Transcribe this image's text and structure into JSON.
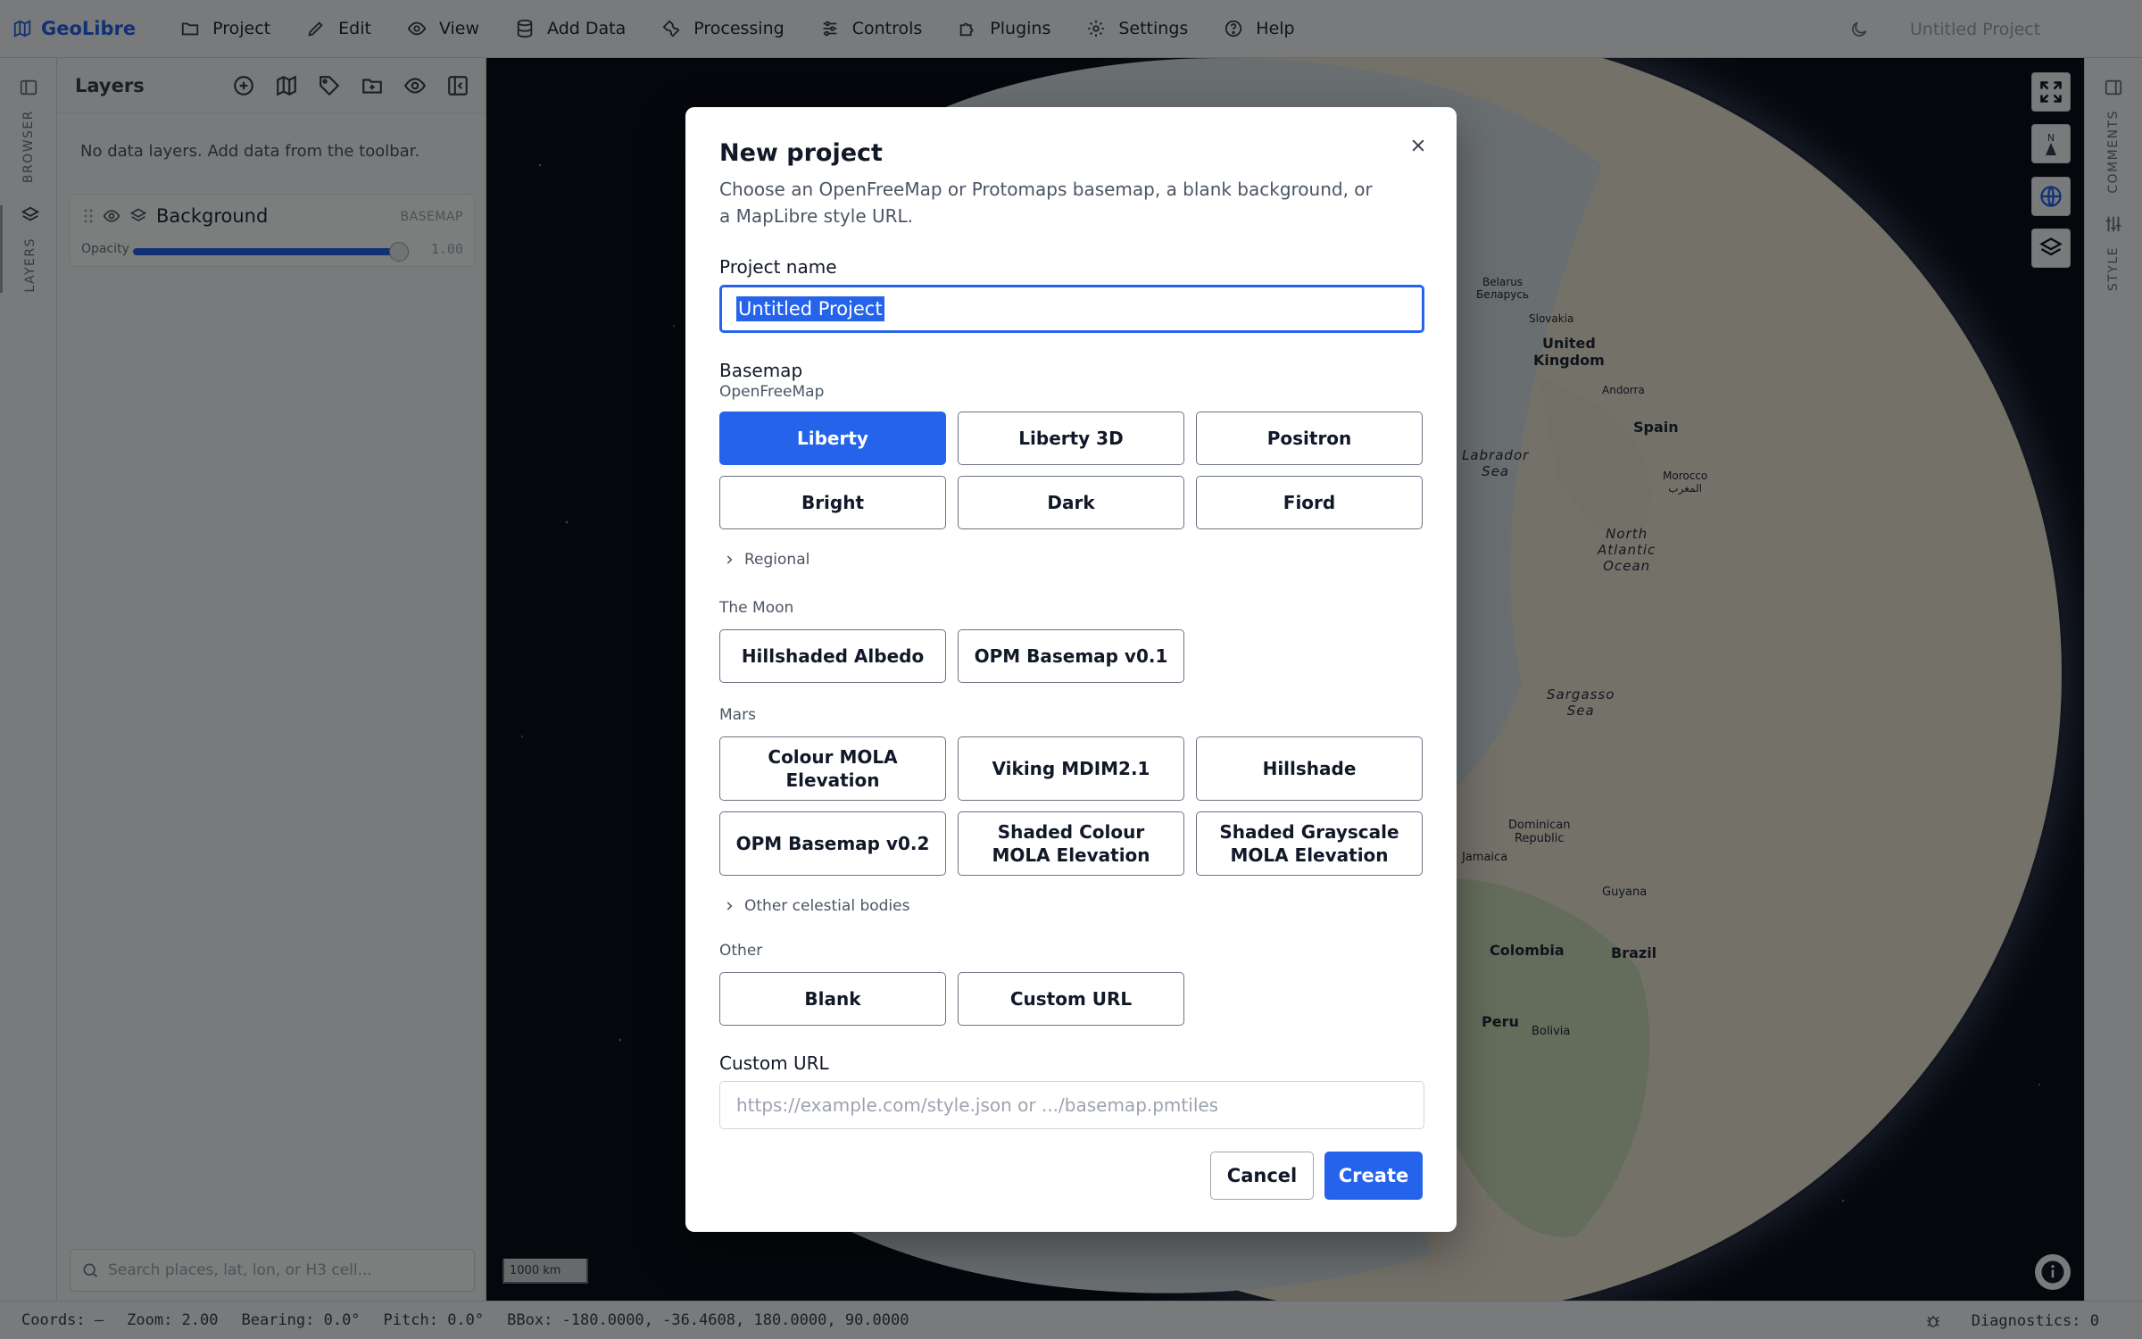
{
  "app": {
    "brand": "GeoLibre",
    "project_title": "Untitled Project",
    "accent_color": "#2563eb"
  },
  "menubar": {
    "items": [
      {
        "label": "Project",
        "icon": "folder-icon"
      },
      {
        "label": "Edit",
        "icon": "pencil-icon"
      },
      {
        "label": "View",
        "icon": "eye-icon"
      },
      {
        "label": "Add Data",
        "icon": "database-icon"
      },
      {
        "label": "Processing",
        "icon": "wrench-icon"
      },
      {
        "label": "Controls",
        "icon": "sliders-icon"
      },
      {
        "label": "Plugins",
        "icon": "puzzle-icon"
      },
      {
        "label": "Settings",
        "icon": "gear-icon"
      },
      {
        "label": "Help",
        "icon": "help-circle-icon"
      }
    ]
  },
  "left_rail": {
    "browser_label": "BROWSER",
    "layers_label": "LAYERS"
  },
  "right_rail": {
    "comments_label": "COMMENTS",
    "style_label": "STYLE"
  },
  "layers_panel": {
    "title": "Layers",
    "empty_message": "No data layers. Add data from the toolbar.",
    "layer": {
      "name": "Background",
      "badge": "BASEMAP",
      "opacity_label": "Opacity",
      "opacity_value": "1.00",
      "opacity_fraction": 1.0
    },
    "search_placeholder": "Search places, lat, lon, or H3 cell..."
  },
  "map": {
    "scale_label": "1000 km",
    "compass_label": "N",
    "labels": [
      {
        "text": "Belarus\nБеларусь"
      },
      {
        "text": "Slovakia"
      },
      {
        "text": "United\nKingdom"
      },
      {
        "text": "Andorra"
      },
      {
        "text": "Spain"
      },
      {
        "text": "Morocco\nالمغرب"
      },
      {
        "text": "Labrador\nSea"
      },
      {
        "text": "North\nAtlantic\nOcean"
      },
      {
        "text": "Sargasso\nSea"
      },
      {
        "text": "Dominican\nRepublic"
      },
      {
        "text": "Jamaica"
      },
      {
        "text": "Guyana"
      },
      {
        "text": "Colombia"
      },
      {
        "text": "Brazil"
      },
      {
        "text": "Peru"
      },
      {
        "text": "Bolivia"
      }
    ]
  },
  "statusbar": {
    "coords": "Coords: —",
    "zoom": "Zoom: 2.00",
    "bearing": "Bearing: 0.0°",
    "pitch": "Pitch: 0.0°",
    "bbox": "BBox: -180.0000, -36.4608, 180.0000, 90.0000",
    "diagnostics": "Diagnostics: 0"
  },
  "modal": {
    "title": "New project",
    "description": "Choose an OpenFreeMap or Protomaps basemap, a blank background, or a MapLibre style URL.",
    "project_name_label": "Project name",
    "project_name_value": "Untitled Project",
    "basemap_label": "Basemap",
    "openfreemap_label": "OpenFreeMap",
    "openfreemap_options": [
      "Liberty",
      "Liberty 3D",
      "Positron",
      "Bright",
      "Dark",
      "Fiord"
    ],
    "selected_option": "Liberty",
    "regional_label": "Regional",
    "moon_label": "The Moon",
    "moon_options": [
      "Hillshaded Albedo",
      "OPM Basemap v0.1"
    ],
    "mars_label": "Mars",
    "mars_options": [
      "Colour MOLA Elevation",
      "Viking MDIM2.1",
      "Hillshade",
      "OPM Basemap v0.2",
      "Shaded Colour MOLA Elevation",
      "Shaded Grayscale MOLA Elevation"
    ],
    "other_bodies_label": "Other celestial bodies",
    "other_label": "Other",
    "other_options": [
      "Blank",
      "Custom URL"
    ],
    "custom_url_label": "Custom URL",
    "custom_url_placeholder": "https://example.com/style.json or .../basemap.pmtiles",
    "cancel_label": "Cancel",
    "create_label": "Create"
  }
}
